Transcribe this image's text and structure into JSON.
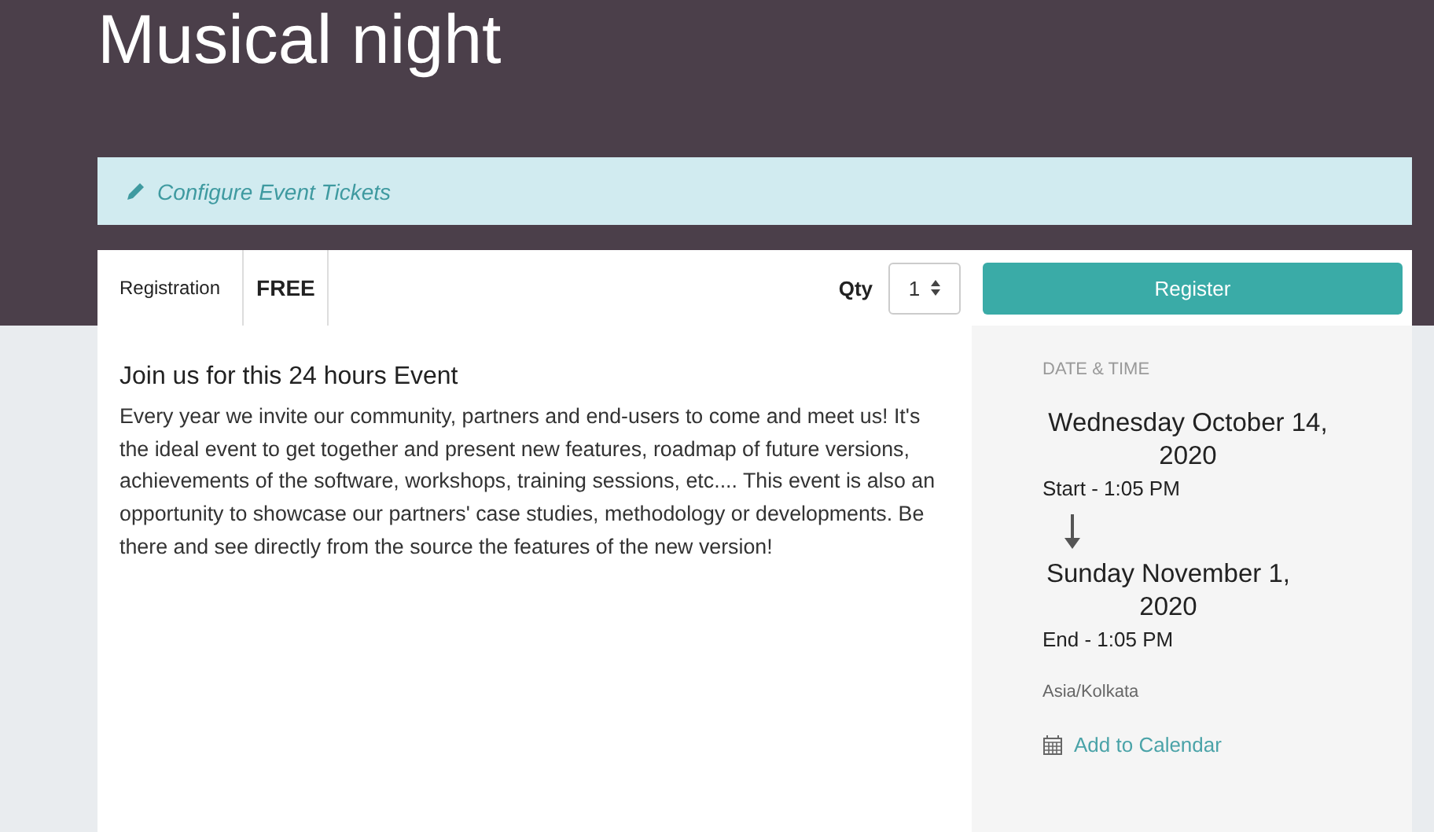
{
  "event": {
    "title": "Musical night"
  },
  "alert": {
    "label": "Configure Event Tickets"
  },
  "ticket": {
    "name": "Registration",
    "price": "FREE",
    "qty_label": "Qty",
    "qty_value": "1",
    "button": "Register"
  },
  "description": {
    "heading": "Join us for this 24 hours Event",
    "text": "Every year we invite our community, partners and end-users to come and meet us! It's the ideal event to get together and present new features, roadmap of future versions, achievements of the software, workshops, training sessions, etc.... This event is also an opportunity to showcase our partners' case studies, methodology or developments. Be there and see directly from the source the features of the new version!"
  },
  "date_time": {
    "heading": "DATE & TIME",
    "start_date": "Wednesday October 14, 2020",
    "start_time": "Start - 1:05 PM",
    "end_date": "Sunday November 1, 2020",
    "end_time": "End - 1:05 PM",
    "timezone": "Asia/Kolkata",
    "calendar_link": "Add to Calendar"
  }
}
